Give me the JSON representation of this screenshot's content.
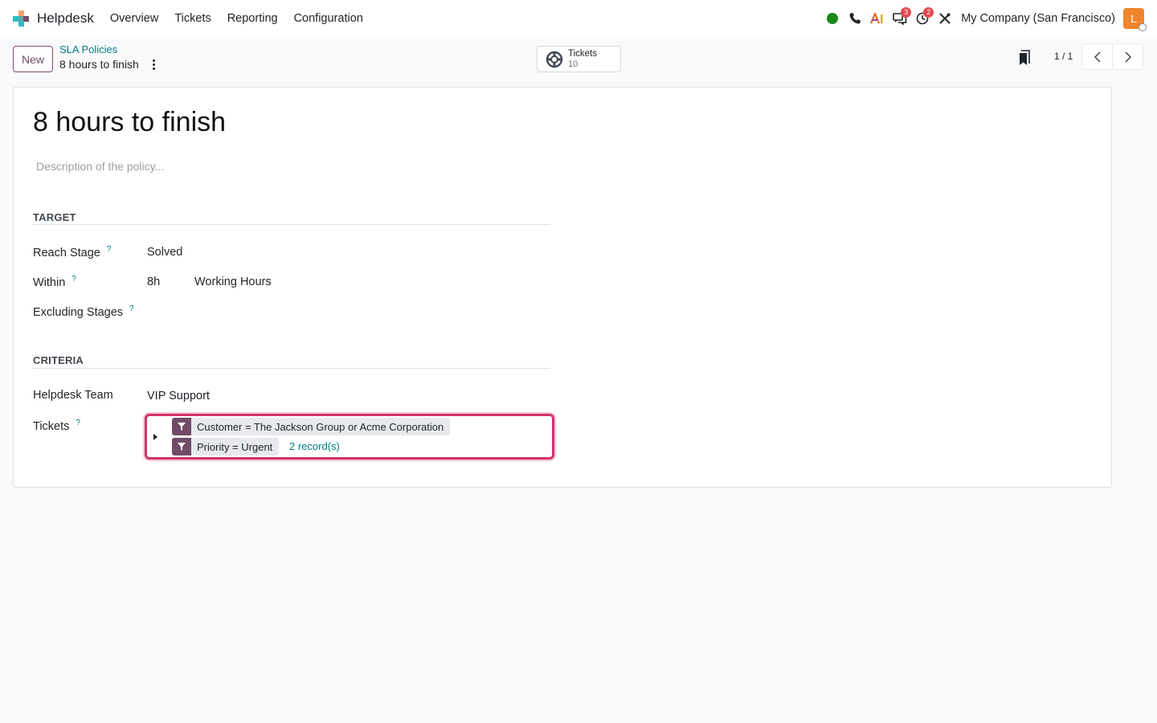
{
  "navbar": {
    "app_name": "Helpdesk",
    "menu": [
      "Overview",
      "Tickets",
      "Reporting",
      "Configuration"
    ],
    "badges": {
      "messages": "3",
      "activities": "2"
    },
    "company": "My Company (San Francisco)",
    "avatar_initial": "L"
  },
  "control": {
    "new_label": "New",
    "breadcrumb_parent": "SLA Policies",
    "breadcrumb_current": "8 hours to finish",
    "smart_button": {
      "label": "Tickets",
      "value": "10"
    },
    "pager": "1 / 1"
  },
  "form": {
    "title": "8 hours to finish",
    "description_placeholder": "Description of the policy...",
    "target_section": "TARGET",
    "reach_stage_label": "Reach Stage",
    "reach_stage_value": "Solved",
    "within_label": "Within",
    "within_value": "8h",
    "within_unit": "Working Hours",
    "excluding_label": "Excluding Stages",
    "criteria_section": "CRITERIA",
    "team_label": "Helpdesk Team",
    "team_value": "VIP Support",
    "tickets_label": "Tickets",
    "help_mark": "?",
    "domain": {
      "conditions": [
        "Customer = The Jackson Group or Acme Corporation",
        "Priority = Urgent"
      ],
      "records": "2 record(s)"
    }
  },
  "colors": {
    "brand": "#714b67",
    "link": "#017e84",
    "focus": "#d1336f"
  }
}
